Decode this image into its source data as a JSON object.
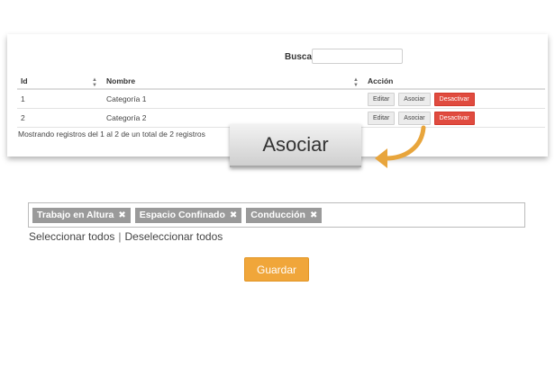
{
  "search": {
    "label": "Buscar:",
    "value": ""
  },
  "table": {
    "headers": {
      "id": "Id",
      "name": "Nombre",
      "action": "Acción"
    },
    "rows": [
      {
        "id": "1",
        "name": "Categoría 1"
      },
      {
        "id": "2",
        "name": "Categoría 2"
      }
    ],
    "actions": {
      "edit": "Editar",
      "associate": "Asociar",
      "deactivate": "Desactivar"
    },
    "info": "Mostrando registros del 1 al 2 de un total de 2 registros"
  },
  "callout": {
    "label": "Asociar"
  },
  "tags": [
    {
      "label": "Trabajo en Altura"
    },
    {
      "label": "Espacio Confinado"
    },
    {
      "label": "Conducción"
    }
  ],
  "links": {
    "select_all": "Seleccionar todos",
    "separator": "|",
    "deselect_all": "Deseleccionar todos"
  },
  "save": {
    "label": "Guardar"
  },
  "icons": {
    "sort": "sort-icon",
    "remove": "close-icon",
    "arrow": "curved-arrow-icon"
  },
  "colors": {
    "danger": "#e04b3f",
    "primary": "#f0a63a",
    "arrow": "#e8a53c",
    "tag_bg": "#9a9a9a",
    "button_default": "#ececec"
  }
}
